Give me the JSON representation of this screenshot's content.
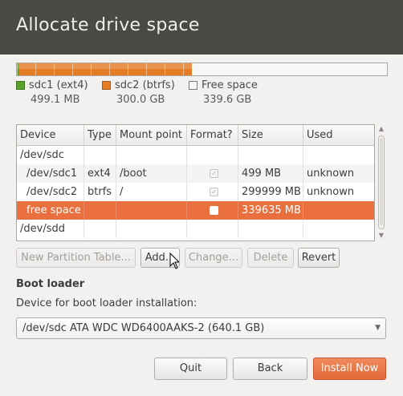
{
  "header": {
    "title": "Allocate drive space"
  },
  "legend": [
    {
      "name": "sdc1 (ext4)",
      "size": "499.1 MB",
      "color": "#5aa22a"
    },
    {
      "name": "sdc2 (btrfs)",
      "size": "300.0 GB",
      "color": "#e47c25"
    },
    {
      "name": "Free space",
      "size": "339.6 GB",
      "color": "#f6f6f6"
    }
  ],
  "table": {
    "columns": [
      "Device",
      "Type",
      "Mount point",
      "Format?",
      "Size",
      "Used"
    ],
    "rows": [
      {
        "device": "/dev/sdc",
        "type": "",
        "mount": "",
        "format": "",
        "size": "",
        "used": ""
      },
      {
        "device": "/dev/sdc1",
        "type": "ext4",
        "mount": "/boot",
        "format": "✓",
        "size": "499 MB",
        "used": "unknown"
      },
      {
        "device": "/dev/sdc2",
        "type": "btrfs",
        "mount": "/",
        "format": "✓",
        "size": "299999 MB",
        "used": "unknown"
      },
      {
        "device": "free space",
        "type": "",
        "mount": "",
        "format": "",
        "size": "339635 MB",
        "used": ""
      },
      {
        "device": "/dev/sdd",
        "type": "",
        "mount": "",
        "format": "",
        "size": "",
        "used": ""
      }
    ]
  },
  "actions": {
    "new_partition_table": "New Partition Table...",
    "add": "Add...",
    "change": "Change...",
    "delete": "Delete",
    "revert": "Revert"
  },
  "bootloader": {
    "title": "Boot loader",
    "label": "Device for boot loader installation:",
    "selected": "/dev/sdc ATA WDC WD6400AAKS-2 (640.1 GB)"
  },
  "footer": {
    "quit": "Quit",
    "back": "Back",
    "install": "Install Now"
  },
  "colors": {
    "accent": "#e9703e",
    "header_bg": "#4b4945"
  }
}
